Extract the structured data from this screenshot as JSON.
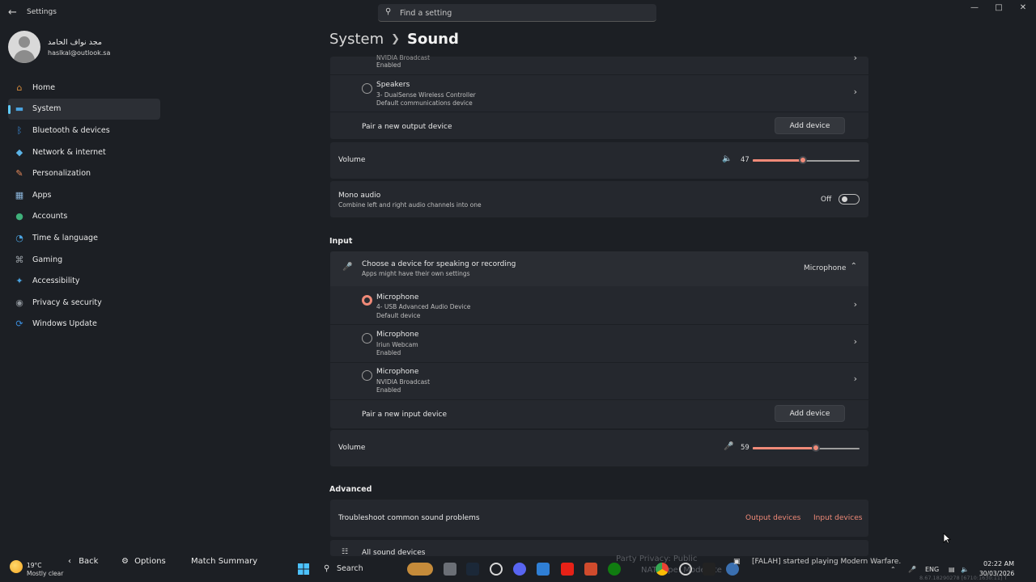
{
  "app": {
    "title": "Settings",
    "search_placeholder": "Find a setting"
  },
  "profile": {
    "name": "مجد نواف الحامد",
    "email": "haslkal@outlook.sa"
  },
  "nav": [
    {
      "label": "Home",
      "icon": "home-icon",
      "color": "#d68b3c"
    },
    {
      "label": "System",
      "icon": "system-icon",
      "color": "#4aa3e0",
      "active": true
    },
    {
      "label": "Bluetooth & devices",
      "icon": "bluetooth-icon",
      "color": "#3b8fe0"
    },
    {
      "label": "Network & internet",
      "icon": "wifi-icon",
      "color": "#5bb3e6"
    },
    {
      "label": "Personalization",
      "icon": "brush-icon",
      "color": "#e88a5a"
    },
    {
      "label": "Apps",
      "icon": "apps-icon",
      "color": "#8ab4d9"
    },
    {
      "label": "Accounts",
      "icon": "accounts-icon",
      "color": "#3fb07a"
    },
    {
      "label": "Time & language",
      "icon": "clock-globe-icon",
      "color": "#4aa3e0"
    },
    {
      "label": "Gaming",
      "icon": "controller-icon",
      "color": "#9aa0a6"
    },
    {
      "label": "Accessibility",
      "icon": "accessibility-icon",
      "color": "#4aa3e0"
    },
    {
      "label": "Privacy & security",
      "icon": "shield-icon",
      "color": "#8d9399"
    },
    {
      "label": "Windows Update",
      "icon": "update-icon",
      "color": "#3b8fe0"
    }
  ],
  "breadcrumb": {
    "parent": "System",
    "current": "Sound"
  },
  "output": {
    "partial_device": {
      "name": "NVIDIA Broadcast",
      "status": "Enabled"
    },
    "speakers": {
      "name": "Speakers",
      "sub": "3- DualSense Wireless Controller",
      "status": "Default communications device"
    },
    "pair_label": "Pair a new output device",
    "add_label": "Add device",
    "volume_label": "Volume",
    "volume_value": "47",
    "volume_level": 0.47
  },
  "mono": {
    "title": "Mono audio",
    "sub": "Combine left and right audio channels into one",
    "state": "Off"
  },
  "input": {
    "section_title": "Input",
    "choose_title": "Choose a device for speaking or recording",
    "choose_sub": "Apps might have their own settings",
    "selected": "Microphone",
    "devices": [
      {
        "name": "Microphone",
        "sub": "4- USB Advanced Audio Device",
        "status": "Default device",
        "selected": true
      },
      {
        "name": "Microphone",
        "sub": "Iriun Webcam",
        "status": "Enabled"
      },
      {
        "name": "Microphone",
        "sub": "NVIDIA Broadcast",
        "status": "Enabled"
      }
    ],
    "pair_label": "Pair a new input device",
    "add_label": "Add device",
    "volume_label": "Volume",
    "volume_value": "59",
    "volume_level": 0.59
  },
  "advanced": {
    "section_title": "Advanced",
    "troubleshoot": "Troubleshoot common sound problems",
    "output_link": "Output devices",
    "input_link": "Input devices",
    "all_devices": "All sound devices"
  },
  "overlay": {
    "temp": "19°C",
    "weather": "Mostly clear",
    "back": "Back",
    "options": "Options",
    "match_summary": "Match Summary",
    "ghost1": "Party Privacy: Public",
    "ghost2": "NAT Type: Moderate",
    "notification": "[FALAH] started playing Modern Warfare."
  },
  "taskbar": {
    "search": "Search",
    "lang": "ENG",
    "time": "02:22 AM",
    "date": "30/03/2026",
    "build": "8.67.18290278 [6710:1630:11] T"
  }
}
